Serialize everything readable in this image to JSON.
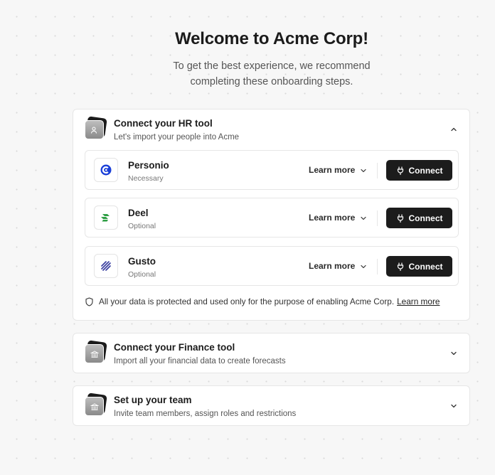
{
  "header": {
    "title": "Welcome to Acme Corp!",
    "subtitle_line1": "To get the best experience, we recommend",
    "subtitle_line2": "completing these onboarding steps."
  },
  "hr_section": {
    "title": "Connect your HR tool",
    "description": "Let's import your people into Acme",
    "expanded": true,
    "tools": [
      {
        "name": "Personio",
        "status": "Necessary",
        "learn_more": "Learn more",
        "connect": "Connect",
        "logo": "personio-logo-icon"
      },
      {
        "name": "Deel",
        "status": "Optional",
        "learn_more": "Learn more",
        "connect": "Connect",
        "logo": "deel-logo-icon"
      },
      {
        "name": "Gusto",
        "status": "Optional",
        "learn_more": "Learn more",
        "connect": "Connect",
        "logo": "gusto-logo-icon"
      }
    ],
    "privacy_text": "All your data is protected and used only for the purpose of enabling Acme Corp.",
    "privacy_link": "Learn more"
  },
  "finance_section": {
    "title": "Connect your Finance tool",
    "description": "Import all your financial data to create forecasts",
    "expanded": false
  },
  "team_section": {
    "title": "Set up your team",
    "description": "Invite team members, assign roles and restrictions",
    "expanded": false
  },
  "colors": {
    "background": "#f7f7f7",
    "card": "#ffffff",
    "button": "#1c1c1c",
    "personio_blue": "#1a3fd8",
    "deel_green": "#2f9e44",
    "gusto_indigo": "#3a3fa0"
  }
}
